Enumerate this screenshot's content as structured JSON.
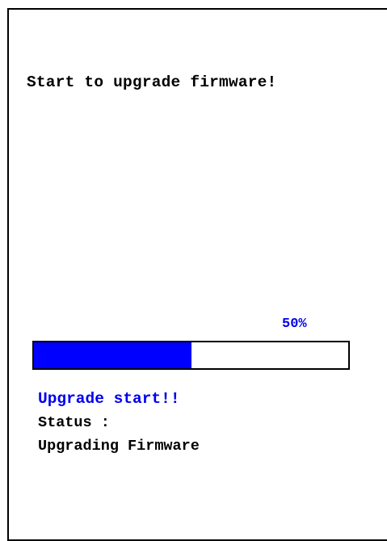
{
  "title": "Start to upgrade firmware!",
  "progress": {
    "percent_label": "50%",
    "value": 0.5,
    "fill_color": "#0000ff"
  },
  "message": "Upgrade start!!",
  "status": {
    "label": "Status :",
    "value": "Upgrading Firmware"
  }
}
